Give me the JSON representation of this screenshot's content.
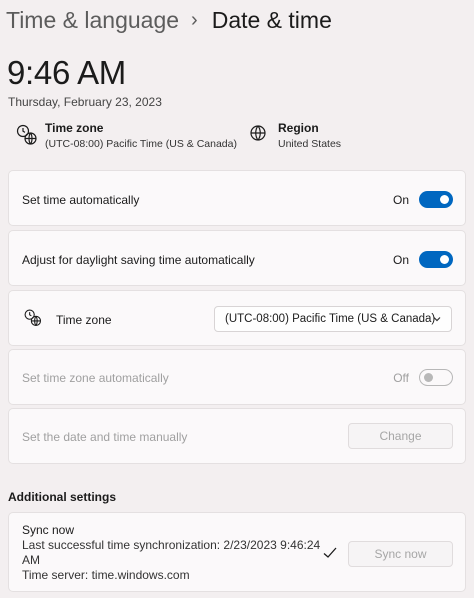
{
  "breadcrumb": {
    "parent": "Time & language",
    "separator": "›",
    "current": "Date & time"
  },
  "clock": {
    "time": "9:46 AM",
    "date": "Thursday, February 23, 2023"
  },
  "summary": {
    "timezone": {
      "title": "Time zone",
      "value": "(UTC-08:00) Pacific Time (US & Canada)",
      "icon": "world-clock-icon"
    },
    "region": {
      "title": "Region",
      "value": "United States",
      "icon": "globe-icon"
    }
  },
  "settings": {
    "set_time_auto": {
      "label": "Set time automatically",
      "state": "On",
      "enabled": true
    },
    "dst_auto": {
      "label": "Adjust for daylight saving time automatically",
      "state": "On",
      "enabled": true
    },
    "timezone": {
      "label": "Time zone",
      "selected": "(UTC-08:00) Pacific Time (US & Canada)",
      "icon": "world-clock-icon"
    },
    "set_tz_auto": {
      "label": "Set time zone automatically",
      "state": "Off",
      "enabled": false
    },
    "manual": {
      "label": "Set the date and time manually",
      "button": "Change",
      "enabled": false
    }
  },
  "additional": {
    "title": "Additional settings",
    "sync": {
      "title": "Sync now",
      "last_sync_line1": "Last successful time synchronization: 2/23/2023 9:46:24",
      "last_sync_line2": "AM",
      "server": "Time server: time.windows.com",
      "button": "Sync now",
      "icon": "checkmark-icon"
    }
  },
  "colors": {
    "accent": "#0067c0",
    "background": "#f3eff0",
    "card": "#fbf9fa"
  }
}
